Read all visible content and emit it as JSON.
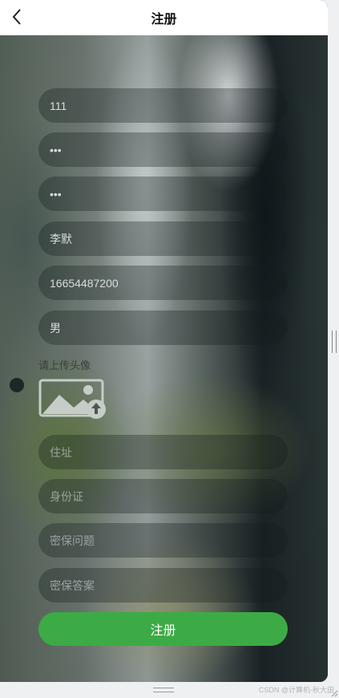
{
  "header": {
    "title": "注册"
  },
  "fields": {
    "username": "111",
    "password": "•••",
    "confirm_password": "•••",
    "name": "李默",
    "phone": "16654487200",
    "gender": "男",
    "address_placeholder": "住址",
    "id_card_placeholder": "身份证",
    "security_question_placeholder": "密保问题",
    "security_answer_placeholder": "密保答案"
  },
  "upload": {
    "label": "请上传头像"
  },
  "submit": {
    "label": "注册"
  },
  "watermark": "CSDN @计算机-秋大田",
  "colors": {
    "primary": "#3cab45",
    "header_bg": "#ffffff"
  },
  "icons": {
    "back": "back-arrow-icon",
    "upload": "image-upload-icon"
  }
}
